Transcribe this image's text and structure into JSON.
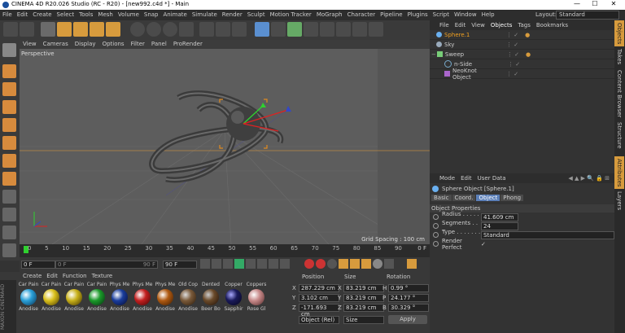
{
  "window": {
    "title": "CINEMA 4D R20.026 Studio (RC - R20) - [new992.c4d *] - Main",
    "controls": [
      "—",
      "☐",
      "✕"
    ]
  },
  "menubar": {
    "items": [
      "File",
      "Edit",
      "Create",
      "Select",
      "Tools",
      "Mesh",
      "Volume",
      "Snap",
      "Animate",
      "Simulate",
      "Render",
      "Sculpt",
      "Motion Tracker",
      "MoGraph",
      "Character",
      "Pipeline",
      "Plugins",
      "Script",
      "Window",
      "Help"
    ],
    "layout_label": "Layout:",
    "layout_value": "Standard"
  },
  "viewport": {
    "menu": [
      "View",
      "Cameras",
      "Display",
      "Options",
      "Filter",
      "Panel",
      "ProRender"
    ],
    "camera": "Perspective",
    "grid_spacing": "Grid Spacing : 100 cm"
  },
  "timeline": {
    "ticks": [
      "0",
      "5",
      "10",
      "15",
      "20",
      "25",
      "30",
      "35",
      "40",
      "45",
      "50",
      "55",
      "60",
      "65",
      "70",
      "75",
      "80",
      "85",
      "90"
    ],
    "end_label": "0 F"
  },
  "transport": {
    "current_frame": "0 F",
    "start_frame": "0 F",
    "end_frame": "90 F",
    "max_frame": "90 F"
  },
  "material_manager": {
    "menu": [
      "Create",
      "Edit",
      "Function",
      "Texture"
    ],
    "top_labels": [
      "Car Pain",
      "Car Pain",
      "Car Pain",
      "Car Pain",
      "Phys Me",
      "Phys Me",
      "Phys Me",
      "Old Cop",
      "Dented",
      "Copper",
      "Coppers"
    ],
    "bottom_labels": [
      "Anodise",
      "Anodise",
      "Anodise",
      "Anodise",
      "Anodise",
      "Anodise",
      "Anodise",
      "Anodise",
      "Beer Bo",
      "Sapphir",
      "Rose Gl"
    ],
    "colors": [
      "#2aa0d8",
      "#d9c01c",
      "#c8b11a",
      "#1b9a2a",
      "#1a3d9c",
      "#c42020",
      "#b05a12",
      "#7a5a3a",
      "#6a4a2a",
      "#1a1a5a",
      "#c88a8a"
    ]
  },
  "coordinates": {
    "headers": [
      "Position",
      "Size",
      "Rotation"
    ],
    "rows": [
      {
        "axis": "X",
        "pos": "287.229 cm",
        "size_axis": "X",
        "size": "83.219 cm",
        "rot_axis": "H",
        "rot": "0.99 °"
      },
      {
        "axis": "Y",
        "pos": "3.102 cm",
        "size_axis": "Y",
        "size": "83.219 cm",
        "rot_axis": "P",
        "rot": "24.177 °"
      },
      {
        "axis": "Z",
        "pos": "-171.693 cm",
        "size_axis": "Z",
        "size": "83.219 cm",
        "rot_axis": "B",
        "rot": "30.329 °"
      }
    ],
    "mode_select": "Object (Rel)",
    "size_select": "Size",
    "apply": "Apply"
  },
  "object_manager": {
    "menu": [
      "File",
      "Edit",
      "View",
      "Objects",
      "Tags",
      "Bookmarks"
    ],
    "items": [
      {
        "name": "Sphere.1",
        "indent": 0,
        "color": "#f0a020",
        "icon": "#6ab0f0"
      },
      {
        "name": "Sky",
        "indent": 0,
        "color": "#ccc",
        "icon": "#9ab"
      },
      {
        "name": "Sweep",
        "indent": 0,
        "color": "#ccc",
        "icon": "#7c7"
      },
      {
        "name": "n-Side",
        "indent": 1,
        "color": "#ccc",
        "icon": "#7ac"
      },
      {
        "name": "NeoKnot Object",
        "indent": 1,
        "color": "#ccc",
        "icon": "#a6c"
      }
    ]
  },
  "attribute_manager": {
    "menu": [
      "Mode",
      "Edit",
      "User Data"
    ],
    "object_title": "Sphere Object [Sphere.1]",
    "tabs": [
      "Basic",
      "Coord.",
      "Object",
      "Phong"
    ],
    "active_tab": "Object",
    "section": "Object Properties",
    "radius_label": "Radius . . . . . .",
    "radius": "41.609 cm",
    "segments_label": "Segments . . .",
    "segments": "24",
    "type_label": "Type . . . . . . . .",
    "type": "Standard",
    "perfect_label": "Render Perfect",
    "perfect_check": "✓"
  },
  "side_tabs": [
    "Objects",
    "Takes",
    "Content Browser",
    "Structure",
    "Attributes",
    "Layers"
  ]
}
